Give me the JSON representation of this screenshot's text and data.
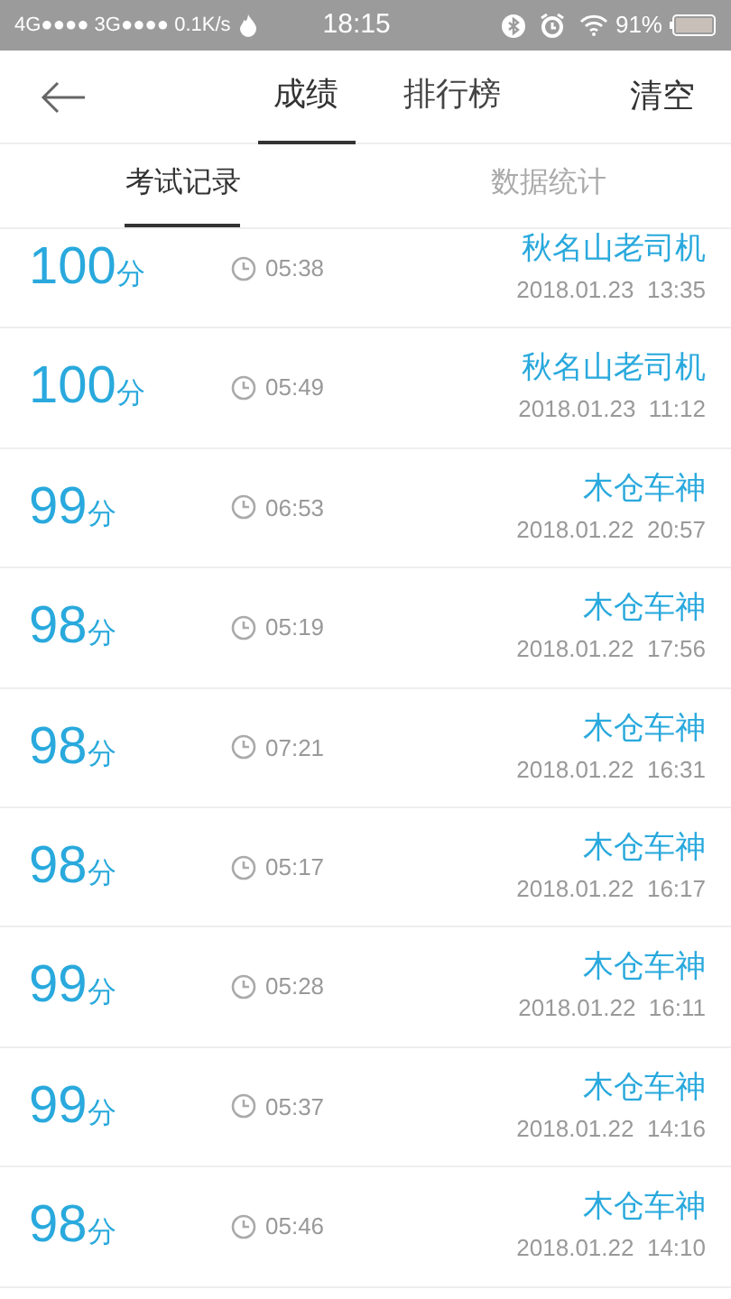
{
  "status_bar": {
    "network": "4G●●●● 3G●●●● 0.1K/s",
    "time": "18:15",
    "battery": "91%"
  },
  "header": {
    "tabs": [
      {
        "label": "成绩",
        "selected": true
      },
      {
        "label": "排行榜",
        "selected": false
      }
    ],
    "action": "清空"
  },
  "sub_tabs": [
    {
      "label": "考试记录",
      "selected": true
    },
    {
      "label": "数据统计",
      "selected": false
    }
  ],
  "records": [
    {
      "score": "100",
      "unit": "分",
      "duration": "05:38",
      "name": "秋名山老司机",
      "date": "2018.01.23  13:35"
    },
    {
      "score": "100",
      "unit": "分",
      "duration": "05:49",
      "name": "秋名山老司机",
      "date": "2018.01.23  11:12"
    },
    {
      "score": "99",
      "unit": "分",
      "duration": "06:53",
      "name": "木仓车神",
      "date": "2018.01.22  20:57"
    },
    {
      "score": "98",
      "unit": "分",
      "duration": "05:19",
      "name": "木仓车神",
      "date": "2018.01.22  17:56"
    },
    {
      "score": "98",
      "unit": "分",
      "duration": "07:21",
      "name": "木仓车神",
      "date": "2018.01.22  16:31"
    },
    {
      "score": "98",
      "unit": "分",
      "duration": "05:17",
      "name": "木仓车神",
      "date": "2018.01.22  16:17"
    },
    {
      "score": "99",
      "unit": "分",
      "duration": "05:28",
      "name": "木仓车神",
      "date": "2018.01.22  16:11"
    },
    {
      "score": "99",
      "unit": "分",
      "duration": "05:37",
      "name": "木仓车神",
      "date": "2018.01.22  14:16"
    },
    {
      "score": "98",
      "unit": "分",
      "duration": "05:46",
      "name": "木仓车神",
      "date": "2018.01.22  14:10"
    }
  ]
}
